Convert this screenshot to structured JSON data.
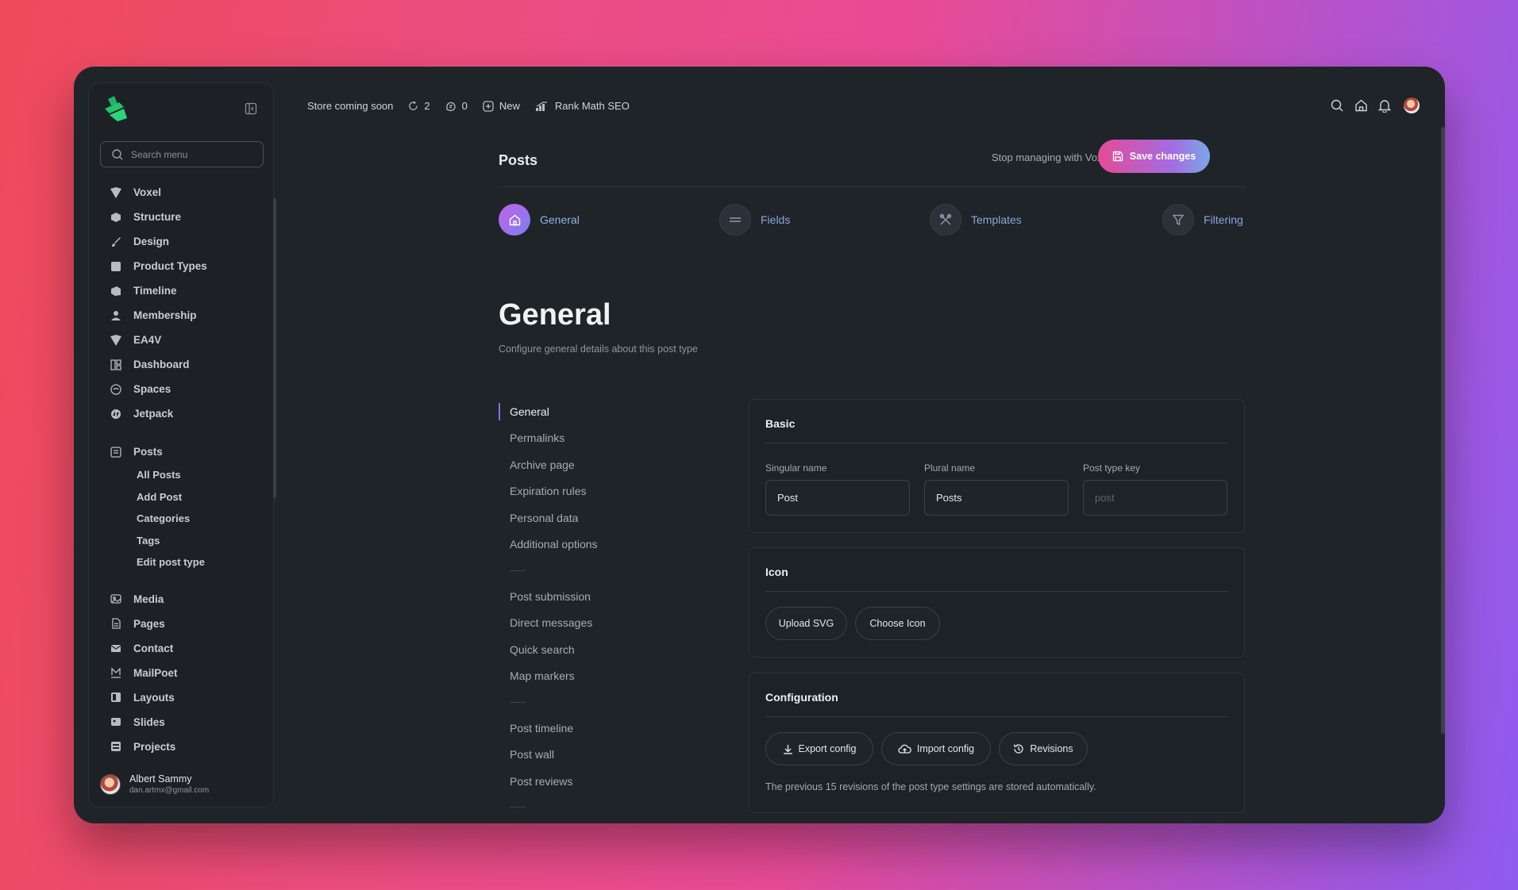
{
  "sidebar": {
    "search_placeholder": "Search menu",
    "menu": [
      {
        "label": "Voxel",
        "icon": "voxel-icon"
      },
      {
        "label": "Structure",
        "icon": "structure-icon"
      },
      {
        "label": "Design",
        "icon": "brush-icon"
      },
      {
        "label": "Product Types",
        "icon": "product-types-icon"
      },
      {
        "label": "Timeline",
        "icon": "timeline-icon"
      },
      {
        "label": "Membership",
        "icon": "membership-icon"
      },
      {
        "label": "EA4V",
        "icon": "ea4v-icon"
      },
      {
        "label": "Dashboard",
        "icon": "dashboard-icon"
      },
      {
        "label": "Spaces",
        "icon": "spaces-icon"
      },
      {
        "label": "Jetpack",
        "icon": "jetpack-icon"
      }
    ],
    "posts": {
      "label": "Posts",
      "icon": "posts-icon",
      "sub": [
        "All Posts",
        "Add Post",
        "Categories",
        "Tags",
        "Edit post type"
      ]
    },
    "menu2": [
      {
        "label": "Media",
        "icon": "media-icon"
      },
      {
        "label": "Pages",
        "icon": "pages-icon"
      },
      {
        "label": "Contact",
        "icon": "mail-icon"
      },
      {
        "label": "MailPoet",
        "icon": "mailpoet-icon"
      },
      {
        "label": "Layouts",
        "icon": "layouts-icon"
      },
      {
        "label": "Slides",
        "icon": "slides-icon"
      },
      {
        "label": "Projects",
        "icon": "projects-icon"
      }
    ],
    "user": {
      "name": "Albert Sammy",
      "email": "dan.artmx@gmail.com"
    }
  },
  "topbar": {
    "store": "Store coming soon",
    "updates_count": "2",
    "comments_count": "0",
    "new_label": "New",
    "seo_label": "Rank Math SEO"
  },
  "header": {
    "title": "Posts",
    "stop_link": "Stop managing with Voxel",
    "save_label": "Save changes"
  },
  "steps": [
    "General",
    "Fields",
    "Templates",
    "Filtering"
  ],
  "section": {
    "title": "General",
    "subtitle": "Configure general details about this post type"
  },
  "nav": {
    "group1": [
      "General",
      "Permalinks",
      "Archive page",
      "Expiration rules",
      "Personal data",
      "Additional options"
    ],
    "group2": [
      "Post submission",
      "Direct messages",
      "Quick search",
      "Map markers"
    ],
    "group3": [
      "Post timeline",
      "Post wall",
      "Post reviews"
    ]
  },
  "basic": {
    "title": "Basic",
    "singular_label": "Singular name",
    "singular_value": "Post",
    "plural_label": "Plural name",
    "plural_value": "Posts",
    "key_label": "Post type key",
    "key_placeholder": "post"
  },
  "icon_card": {
    "title": "Icon",
    "upload_label": "Upload SVG",
    "choose_label": "Choose Icon"
  },
  "config": {
    "title": "Configuration",
    "export_label": "Export config",
    "import_label": "Import config",
    "revisions_label": "Revisions",
    "note": "The previous 15 revisions of the post type settings are stored automatically."
  },
  "colors": {
    "accent_start": "#e64a95",
    "accent_end": "#7aa7ea",
    "active_step": "#8d6be8",
    "panel_bg": "#1f2428"
  }
}
